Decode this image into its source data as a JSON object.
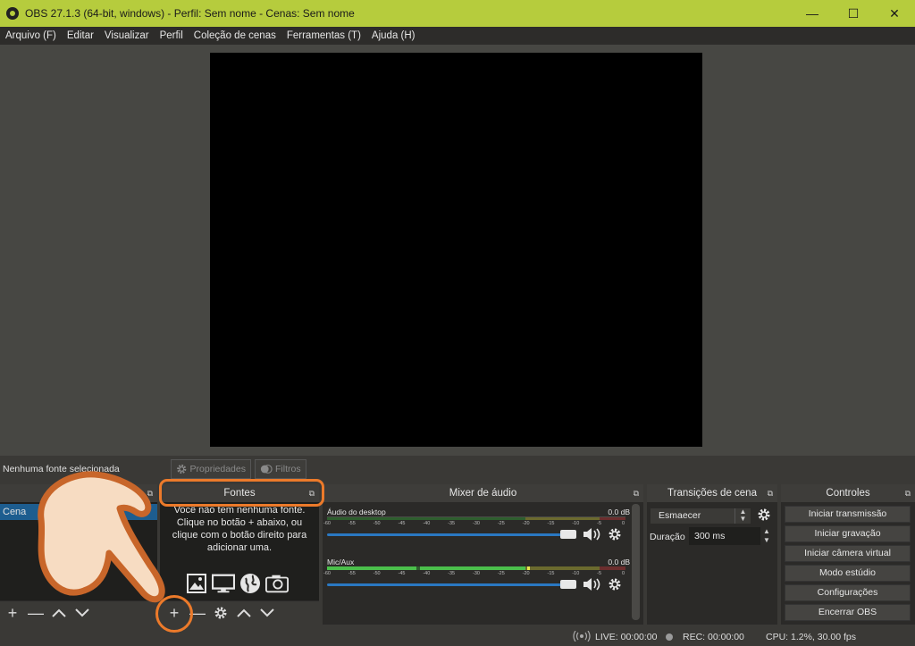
{
  "window": {
    "title": "OBS 27.1.3 (64-bit, windows) - Perfil: Sem nome - Cenas: Sem nome",
    "minimize": "—",
    "maximize": "☐",
    "close": "✕"
  },
  "menu": [
    "Arquivo (F)",
    "Editar",
    "Visualizar",
    "Perfil",
    "Coleção de cenas",
    "Ferramentas (T)",
    "Ajuda (H)"
  ],
  "source_toolbar": {
    "status": "Nenhuma fonte selecionada",
    "properties": "Propriedades",
    "filters": "Filtros"
  },
  "scenes": {
    "item": "Cena"
  },
  "sources": {
    "title": "Fontes",
    "empty_message": "Você não tem nenhuma fonte. Clique no botão + abaixo, ou clique com o botão direito para adicionar uma."
  },
  "mixer": {
    "title": "Mixer de áudio",
    "channels": [
      {
        "name": "Áudio do desktop",
        "db": "0.0 dB"
      },
      {
        "name": "Mic/Aux",
        "db": "0.0 dB"
      }
    ],
    "ticks": [
      "-60",
      "-55",
      "-50",
      "-45",
      "-40",
      "-35",
      "-30",
      "-25",
      "-20",
      "-15",
      "-10",
      "-5",
      "0"
    ]
  },
  "transitions": {
    "title": "Transições de cena",
    "selected": "Esmaecer",
    "duration_label": "Duração",
    "duration_value": "300 ms"
  },
  "controls": {
    "title": "Controles",
    "buttons": [
      "Iniciar transmissão",
      "Iniciar gravação",
      "Iniciar câmera virtual",
      "Modo estúdio",
      "Configurações",
      "Encerrar OBS"
    ]
  },
  "status": {
    "live": "LIVE: 00:00:00",
    "rec": "REC: 00:00:00",
    "cpu": "CPU: 1.2%, 30.00 fps"
  },
  "colors": {
    "titlebar": "#b6cc3d",
    "highlight": "#ec7a2a",
    "slider": "#2a78c2"
  }
}
